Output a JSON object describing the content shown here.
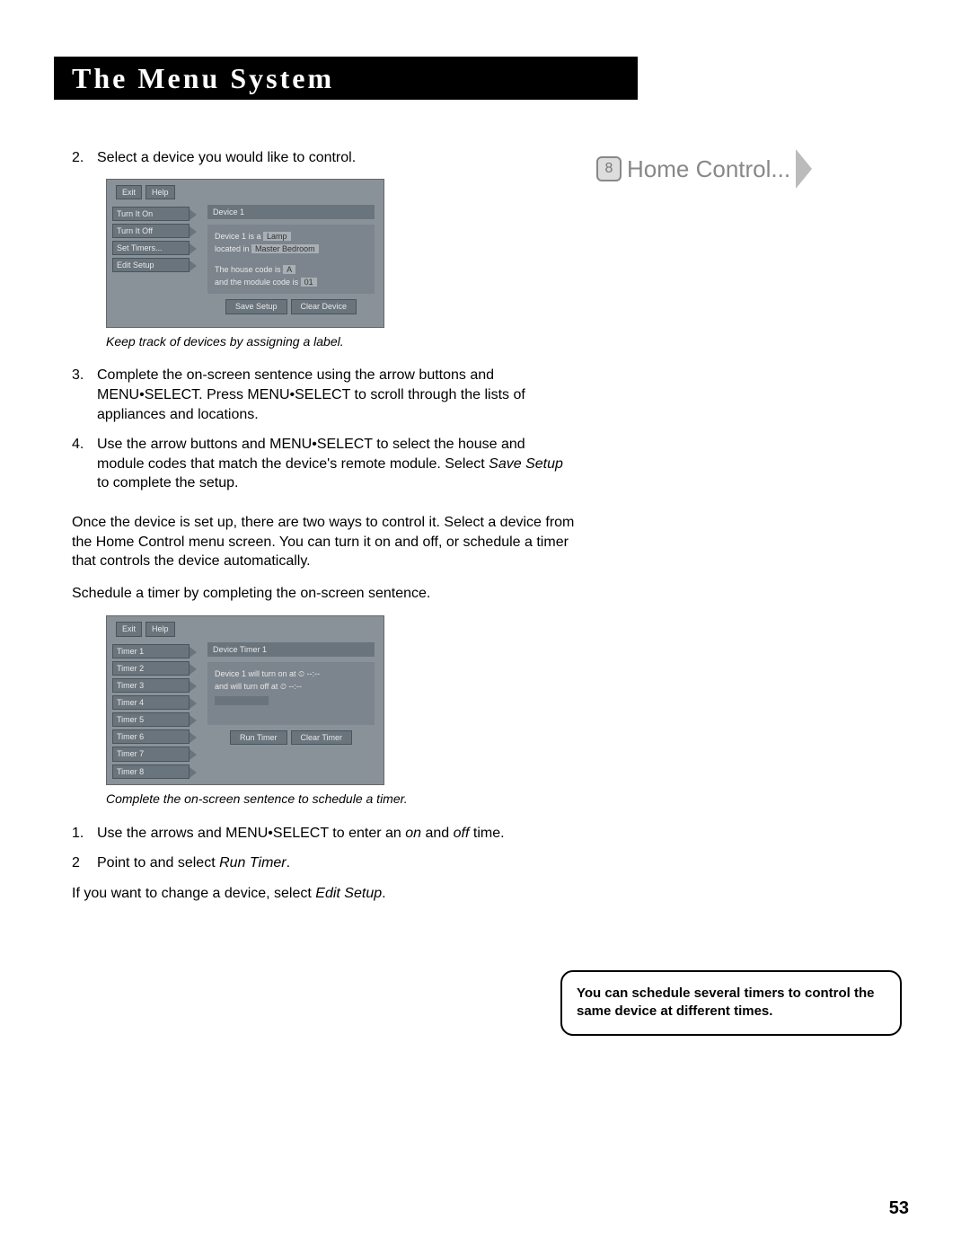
{
  "title": "The Menu System",
  "side_banner": {
    "icon": "8",
    "label": "Home Control..."
  },
  "steps_a": [
    {
      "num": "2.",
      "text": "Select a device you would like to control."
    }
  ],
  "screenshot1": {
    "topbar": [
      "Exit",
      "Help"
    ],
    "left": [
      "Turn It On",
      "Turn It Off",
      "Set Timers...",
      "Edit Setup"
    ],
    "panel_title": "Device 1",
    "line1_a": "Device 1 is a",
    "line1_b": "Lamp",
    "line2_a": "located in",
    "line2_b": "Master Bedroom",
    "line3_a": "The house code is",
    "line3_b": "A",
    "line4_a": "and the module code is",
    "line4_b": "01",
    "foot": [
      "Save Setup",
      "Clear Device"
    ]
  },
  "caption1": "Keep track of devices by assigning a label.",
  "steps_b": [
    {
      "num": "3.",
      "text": "Complete the on-screen sentence using the arrow buttons and MENU•SELECT. Press MENU•SELECT to scroll through the lists of appliances and locations."
    },
    {
      "num": "4.",
      "text_a": "Use the arrow buttons and MENU•SELECT to select the house and module codes that match the device's remote module. Select ",
      "text_i": "Save Setup",
      "text_b": " to complete the setup."
    }
  ],
  "para1": "Once the device is set up, there are two ways to control it. Select a device from the Home Control menu screen. You can turn it on and off, or schedule a timer that controls the device automatically.",
  "para2": "Schedule a timer by completing the on-screen sentence.",
  "screenshot2": {
    "topbar": [
      "Exit",
      "Help"
    ],
    "left": [
      "Timer 1",
      "Timer 2",
      "Timer 3",
      "Timer 4",
      "Timer 5",
      "Timer 6",
      "Timer 7",
      "Timer 8"
    ],
    "panel_title": "Device Timer 1",
    "line1": "Device 1 will turn on at ⏲ --:--",
    "line2": "and will turn off at ⏲ --:--",
    "foot": [
      "Run Timer",
      "Clear Timer"
    ]
  },
  "caption2": "Complete the on-screen sentence to schedule a timer.",
  "steps_c": [
    {
      "num": "1.",
      "text_a": "Use the arrows and MENU•SELECT to enter an ",
      "text_i1": "on",
      "text_mid": " and ",
      "text_i2": "off",
      "text_b": " time."
    },
    {
      "num": "2",
      "text_a": "Point to and select ",
      "text_i1": "Run Timer",
      "text_b": "."
    }
  ],
  "para3_a": "If you want to change a device, select ",
  "para3_i": "Edit Setup",
  "para3_b": ".",
  "tip": "You can schedule several timers to control the same device at different times.",
  "page": "53"
}
